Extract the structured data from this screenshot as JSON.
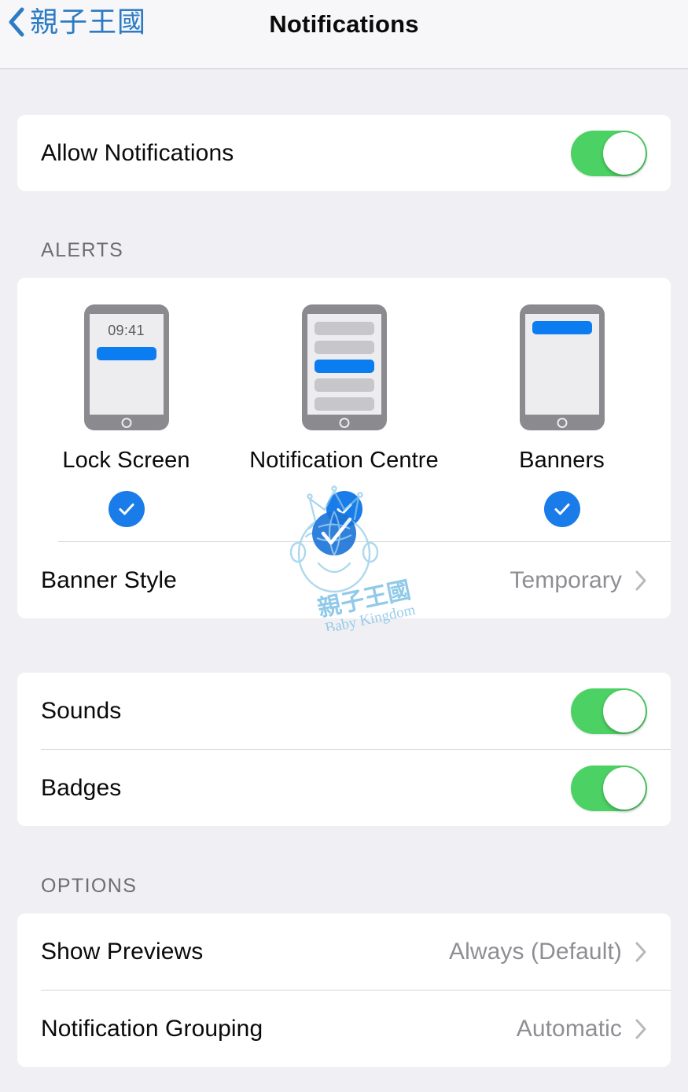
{
  "navbar": {
    "back_label": "親子王國",
    "title": "Notifications",
    "back_icon": "chevron-left-icon",
    "accent_color": "#2C7BC4"
  },
  "allow_section": {
    "row": {
      "label": "Allow Notifications",
      "toggle_state": "on",
      "toggle_color": "#4CD264"
    }
  },
  "alerts_section": {
    "header": "ALERTS",
    "styles": [
      {
        "label": "Lock Screen",
        "selected": true,
        "preview_time": "09:41",
        "preview_type": "lock-screen"
      },
      {
        "label": "Notification Centre",
        "selected": true,
        "preview_type": "notification-centre"
      },
      {
        "label": "Banners",
        "selected": true,
        "preview_type": "banners"
      }
    ],
    "banner_style_row": {
      "label": "Banner Style",
      "value": "Temporary",
      "chevron": "chevron-right-icon"
    },
    "check_color": "#1A7CE8",
    "preview_accent": "#0B7DF0"
  },
  "sounds_section": {
    "rows": [
      {
        "label": "Sounds",
        "toggle_state": "on"
      },
      {
        "label": "Badges",
        "toggle_state": "on"
      }
    ]
  },
  "options_section": {
    "header": "OPTIONS",
    "rows": [
      {
        "label": "Show Previews",
        "value": "Always (Default)",
        "chevron": "chevron-right-icon"
      },
      {
        "label": "Notification Grouping",
        "value": "Automatic",
        "chevron": "chevron-right-icon"
      }
    ]
  },
  "watermark": {
    "primary_text": "親子王國",
    "secondary_text": "Baby Kingdom",
    "icon": "baby-face-crown-logo"
  }
}
